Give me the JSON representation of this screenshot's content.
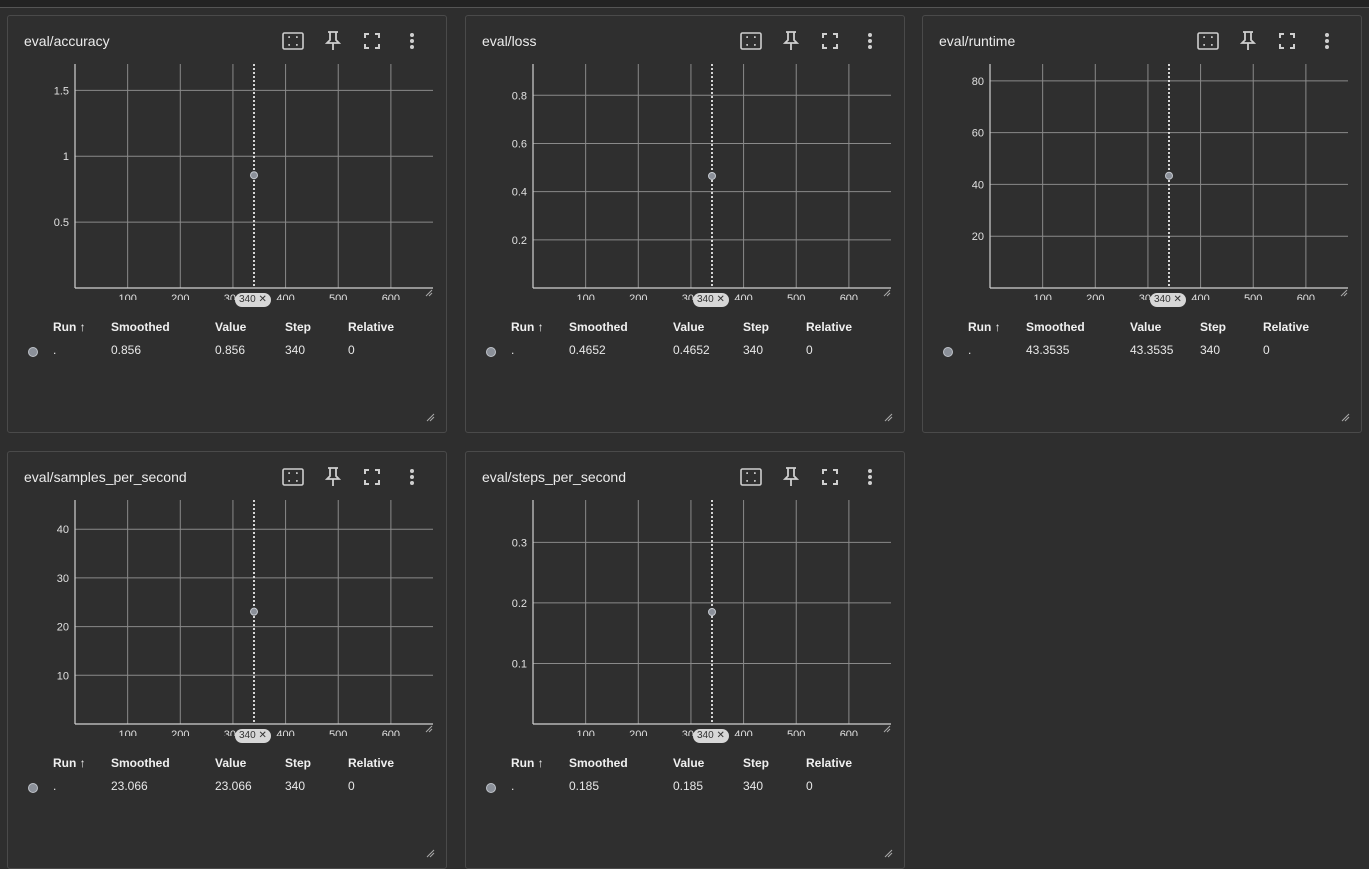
{
  "colors": {
    "background": "#2e2e2e",
    "card": "#2f2f2f",
    "grid": "#8f8f8f",
    "point": "#8b9099",
    "cursor_line": "#ffffff"
  },
  "icons": [
    "fit-domain-icon",
    "pin-icon",
    "fullscreen-icon",
    "more-vert-icon",
    "resize-handle-icon"
  ],
  "table_headers": {
    "run": "Run ↑",
    "smoothed": "Smoothed",
    "value": "Value",
    "step": "Step",
    "relative": "Relative"
  },
  "cards": [
    {
      "title": "eval/accuracy",
      "row": {
        "run": ".",
        "smoothed": "0.856",
        "value": "0.856",
        "step": "340",
        "relative": "0"
      },
      "step_chip": "340",
      "chart_data": {
        "type": "scatter",
        "x_ticks": [
          "100",
          "200",
          "300",
          "400",
          "500",
          "600"
        ],
        "y_ticks": [
          "0.5",
          "1",
          "1.5"
        ],
        "ylim": [
          0,
          1.7
        ],
        "xlim": [
          0,
          680
        ],
        "points": [
          {
            "x": 340,
            "y": 0.856
          }
        ],
        "cursor_step": 340
      }
    },
    {
      "title": "eval/loss",
      "row": {
        "run": ".",
        "smoothed": "0.4652",
        "value": "0.4652",
        "step": "340",
        "relative": "0"
      },
      "step_chip": "340",
      "chart_data": {
        "type": "scatter",
        "x_ticks": [
          "100",
          "200",
          "300",
          "400",
          "500",
          "600"
        ],
        "y_ticks": [
          "0.2",
          "0.4",
          "0.6",
          "0.8"
        ],
        "ylim": [
          0,
          0.93
        ],
        "xlim": [
          0,
          680
        ],
        "points": [
          {
            "x": 340,
            "y": 0.4652
          }
        ],
        "cursor_step": 340
      }
    },
    {
      "title": "eval/runtime",
      "row": {
        "run": ".",
        "smoothed": "43.3535",
        "value": "43.3535",
        "step": "340",
        "relative": "0"
      },
      "step_chip": "340",
      "chart_data": {
        "type": "scatter",
        "x_ticks": [
          "100",
          "200",
          "300",
          "400",
          "500",
          "600"
        ],
        "y_ticks": [
          "20",
          "40",
          "60",
          "80"
        ],
        "ylim": [
          0,
          86.5
        ],
        "xlim": [
          0,
          680
        ],
        "points": [
          {
            "x": 340,
            "y": 43.3535
          }
        ],
        "cursor_step": 340
      }
    },
    {
      "title": "eval/samples_per_second",
      "row": {
        "run": ".",
        "smoothed": "23.066",
        "value": "23.066",
        "step": "340",
        "relative": "0"
      },
      "step_chip": "340",
      "chart_data": {
        "type": "scatter",
        "x_ticks": [
          "100",
          "200",
          "300",
          "400",
          "500",
          "600"
        ],
        "y_ticks": [
          "10",
          "20",
          "30",
          "40"
        ],
        "ylim": [
          0,
          46
        ],
        "xlim": [
          0,
          680
        ],
        "points": [
          {
            "x": 340,
            "y": 23.066
          }
        ],
        "cursor_step": 340
      }
    },
    {
      "title": "eval/steps_per_second",
      "row": {
        "run": ".",
        "smoothed": "0.185",
        "value": "0.185",
        "step": "340",
        "relative": "0"
      },
      "step_chip": "340",
      "chart_data": {
        "type": "scatter",
        "x_ticks": [
          "100",
          "200",
          "300",
          "400",
          "500",
          "600"
        ],
        "y_ticks": [
          "0.1",
          "0.2",
          "0.3"
        ],
        "ylim": [
          0,
          0.37
        ],
        "xlim": [
          0,
          680
        ],
        "points": [
          {
            "x": 340,
            "y": 0.185
          }
        ],
        "cursor_step": 340
      }
    }
  ]
}
